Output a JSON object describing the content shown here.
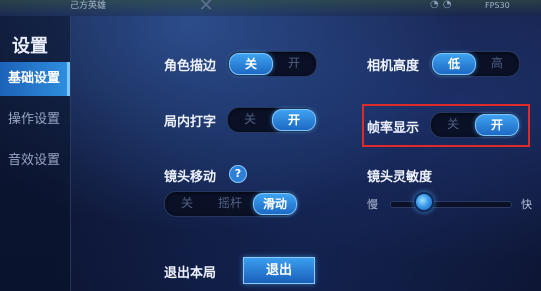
{
  "hud": {
    "team_label": "己方英雄",
    "fps_label": "FPS30"
  },
  "sidebar": {
    "title": "设置",
    "items": [
      {
        "label": "基础设置",
        "active": true
      },
      {
        "label": "操作设置",
        "active": false
      },
      {
        "label": "音效设置",
        "active": false
      }
    ]
  },
  "settings": {
    "outline": {
      "label": "角色描边",
      "options": [
        "关",
        "开"
      ],
      "selected": "关"
    },
    "camera_height": {
      "label": "相机高度",
      "options": [
        "低",
        "高"
      ],
      "selected": "低"
    },
    "in_game_typing": {
      "label": "局内打字",
      "options": [
        "关",
        "开"
      ],
      "selected": "开"
    },
    "fps_display": {
      "label": "帧率显示",
      "options": [
        "关",
        "开"
      ],
      "selected": "开"
    },
    "camera_move": {
      "label": "镜头移动",
      "help": "?",
      "options": [
        "关",
        "摇杆",
        "滑动"
      ],
      "selected": "滑动"
    },
    "camera_sensitivity": {
      "label": "镜头灵敏度",
      "min_label": "慢",
      "max_label": "快",
      "value_fraction": 0.2
    },
    "exit": {
      "label": "退出本局",
      "button": "退出"
    }
  },
  "colors": {
    "accent": "#2f8fe0",
    "highlight_border": "#e02a2a",
    "background": "#101a3c"
  }
}
